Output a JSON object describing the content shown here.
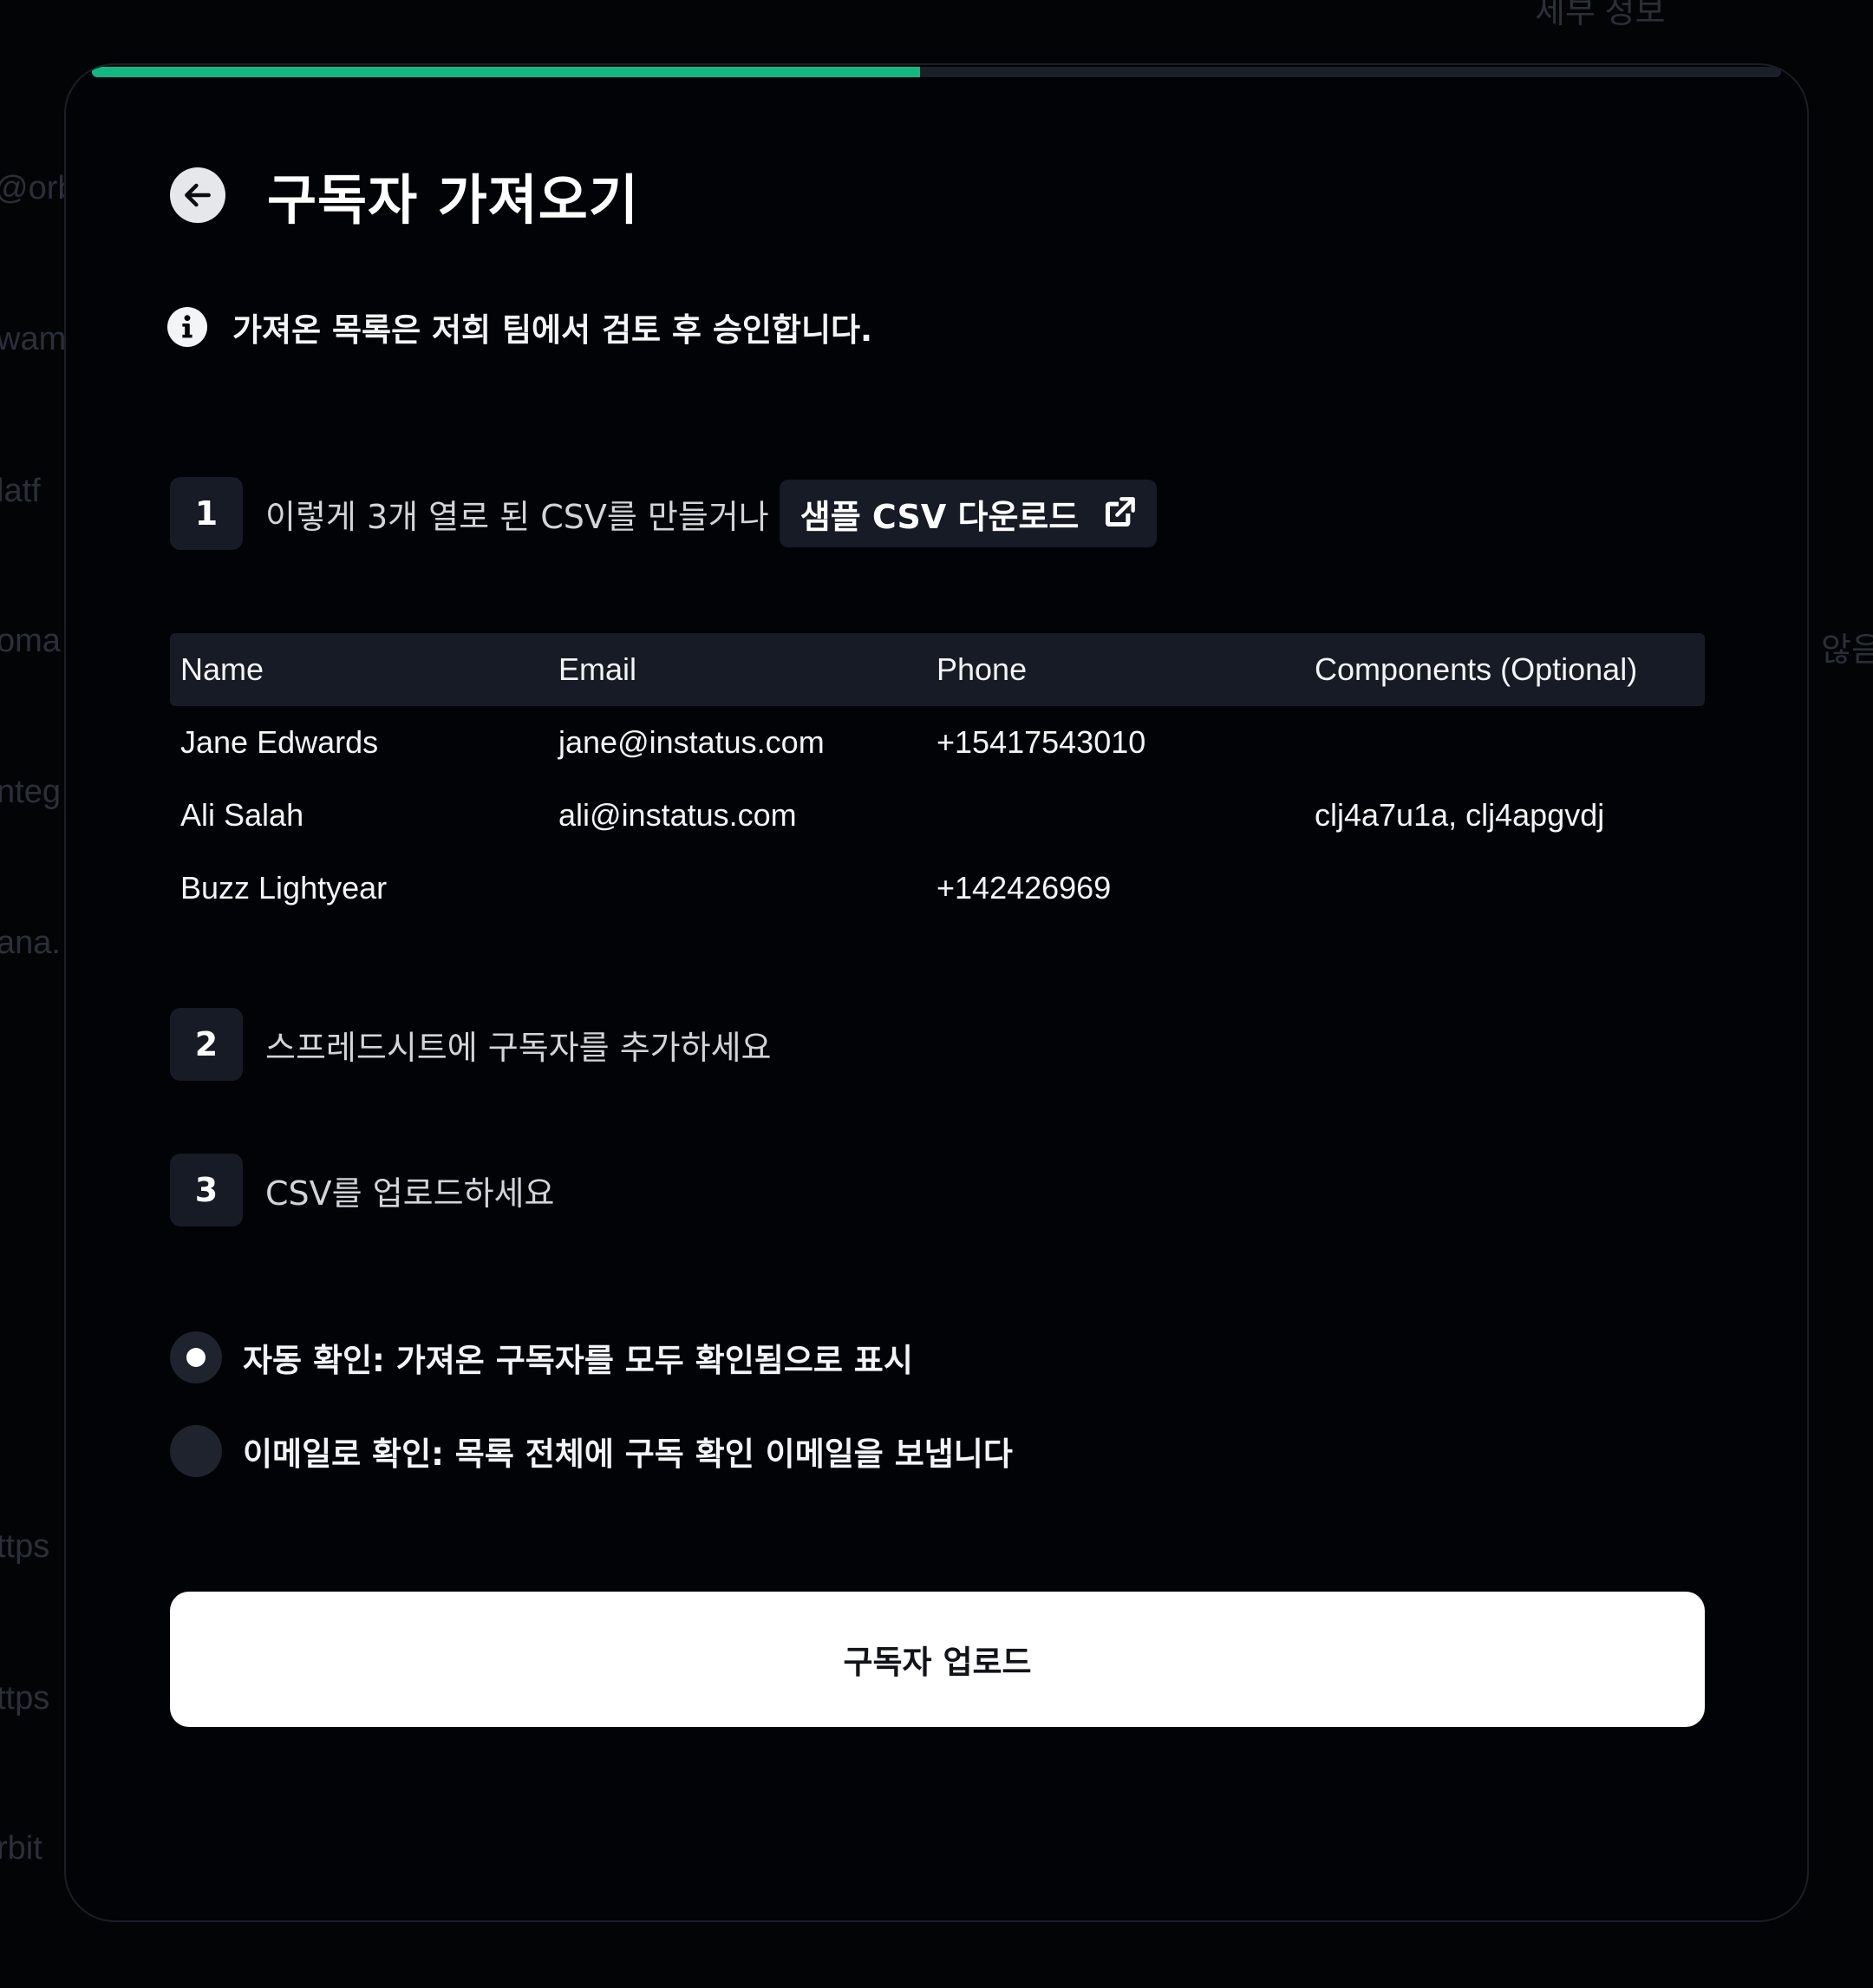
{
  "background": {
    "fragments": [
      "@orb",
      "wam",
      "latf",
      "oma",
      "nteg",
      "ana.",
      "ttps",
      "ttps",
      "rbit",
      "세부 정보",
      "않음"
    ]
  },
  "progress": {
    "value": 0.49,
    "color": "#10b981"
  },
  "header": {
    "back_icon": "arrow-left-icon",
    "title": "구독자 가져오기"
  },
  "notice": {
    "icon": "info-icon",
    "text": "가져온 목록은 저희 팀에서 검토 후 승인합니다."
  },
  "steps": [
    {
      "num": "1",
      "text": "이렇게 3개 열로 된 CSV를 만들거나"
    },
    {
      "num": "2",
      "text": "스프레드시트에 구독자를 추가하세요"
    },
    {
      "num": "3",
      "text": "CSV를 업로드하세요"
    }
  ],
  "sample_button": {
    "label": "샘플 CSV 다운로드",
    "icon": "external-link-icon"
  },
  "table": {
    "columns": [
      "Name",
      "Email",
      "Phone",
      "Components (Optional)"
    ],
    "rows": [
      [
        "Jane Edwards",
        "jane@instatus.com",
        "+15417543010",
        ""
      ],
      [
        "Ali Salah",
        "ali@instatus.com",
        "",
        "clj4a7u1a, clj4apgvdj"
      ],
      [
        "Buzz Lightyear",
        "",
        "+142426969",
        ""
      ]
    ]
  },
  "options": [
    {
      "label": "자동 확인: 가져온 구독자를 모두 확인됨으로 표시",
      "selected": true
    },
    {
      "label": "이메일로 확인: 목록 전체에 구독 확인 이메일을 보냅니다",
      "selected": false
    }
  ],
  "upload_button": {
    "label": "구독자 업로드"
  },
  "colors": {
    "accent": "#10b981",
    "surface": "#161b26",
    "background": "#020306"
  }
}
